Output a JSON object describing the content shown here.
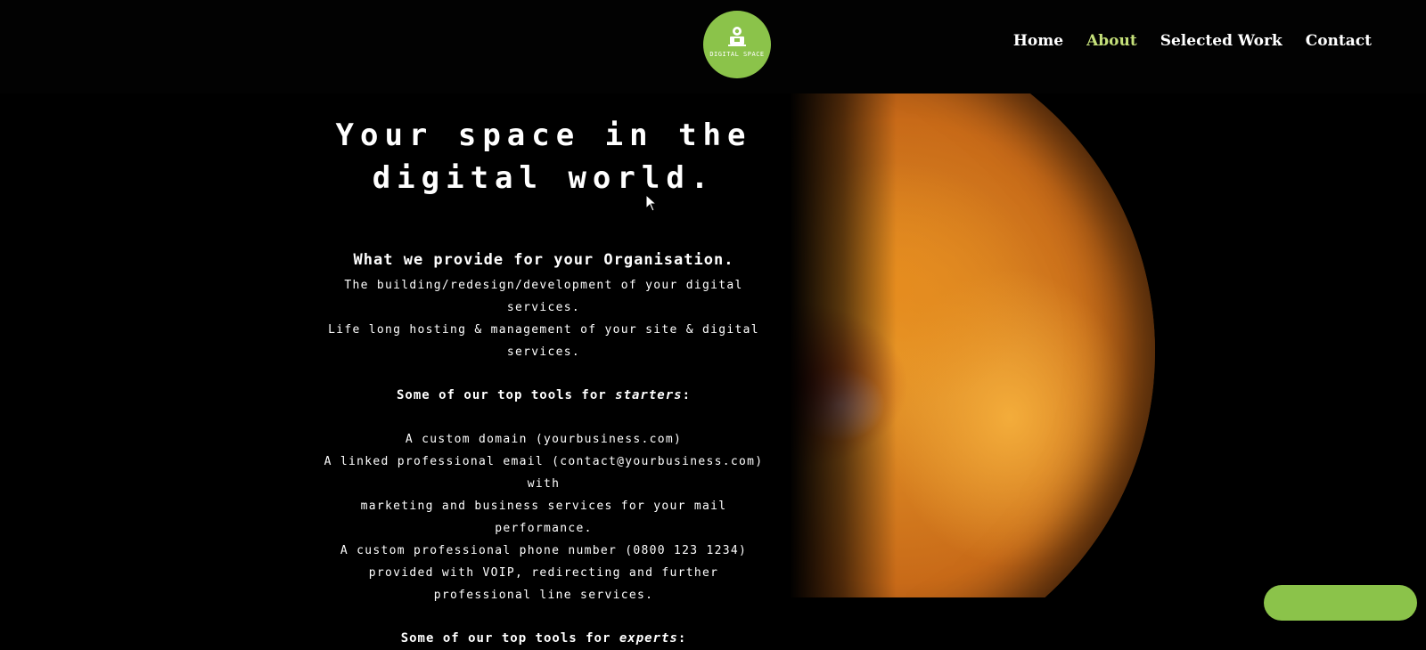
{
  "header": {
    "logo_text": "DIGITAL SPACE",
    "nav": [
      {
        "label": "Home",
        "active": false
      },
      {
        "label": "About",
        "active": true
      },
      {
        "label": "Selected Work",
        "active": false
      },
      {
        "label": "Contact",
        "active": false
      }
    ]
  },
  "main": {
    "hero_line1": "Your space in the",
    "hero_line2": "digital world.",
    "subheading": "What we provide for your Organisation.",
    "provide_lines": [
      "The building/redesign/development of your digital services.",
      "Life long hosting & management of your site & digital",
      "services."
    ],
    "starters_heading_prefix": "Some of our top tools for ",
    "starters_heading_em": "starters",
    "starters_heading_suffix": ":",
    "starters_lines": [
      "A custom domain (yourbusiness.com)",
      "A linked professional email (contact@yourbusiness.com) with",
      "marketing and business services for your mail performance.",
      "A custom professional phone number (0800 123 1234)",
      "provided with VOIP, redirecting and further",
      "professional line services."
    ],
    "experts_heading_prefix": "Some of our top tools for ",
    "experts_heading_em": "experts",
    "experts_heading_suffix": ":"
  },
  "colors": {
    "accent": "#8bc34a",
    "nav_active": "#c5e07a",
    "background": "#000000"
  },
  "icons": {
    "logo": "robot-laptop-icon",
    "cursor": "mouse-pointer-icon"
  }
}
